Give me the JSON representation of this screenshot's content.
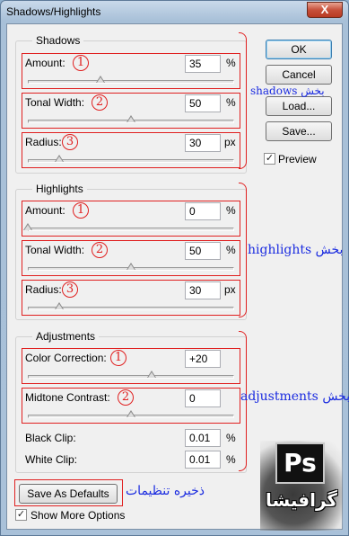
{
  "window": {
    "title": "Shadows/Highlights",
    "close_glyph": "X"
  },
  "shadows": {
    "title": "Shadows",
    "amount": {
      "label": "Amount:",
      "value": "35",
      "unit": "%",
      "level": 0.35
    },
    "tonal_width": {
      "label": "Tonal Width:",
      "value": "50",
      "unit": "%",
      "level": 0.5
    },
    "radius": {
      "label": "Radius:",
      "value": "30",
      "unit": "px",
      "level": 0.15
    }
  },
  "highlights": {
    "title": "Highlights",
    "amount": {
      "label": "Amount:",
      "value": "0",
      "unit": "%",
      "level": 0.0
    },
    "tonal_width": {
      "label": "Tonal Width:",
      "value": "50",
      "unit": "%",
      "level": 0.5
    },
    "radius": {
      "label": "Radius:",
      "value": "30",
      "unit": "px",
      "level": 0.15
    }
  },
  "adjustments": {
    "title": "Adjustments",
    "color_correction": {
      "label": "Color Correction:",
      "value": "+20",
      "level": 0.6
    },
    "midtone_contrast": {
      "label": "Midtone Contrast:",
      "value": "0",
      "level": 0.5
    },
    "black_clip": {
      "label": "Black Clip:",
      "value": "0.01",
      "unit": "%"
    },
    "white_clip": {
      "label": "White Clip:",
      "value": "0.01",
      "unit": "%"
    }
  },
  "buttons": {
    "ok": "OK",
    "cancel": "Cancel",
    "load": "Load...",
    "save": "Save...",
    "save_defaults": "Save As Defaults"
  },
  "checkboxes": {
    "preview": {
      "label": "Preview",
      "checked": true,
      "glyph": "✓"
    },
    "show_more": {
      "label": "Show More Options",
      "checked": true,
      "glyph": "✓"
    }
  },
  "annotations": {
    "num1": "1",
    "num2": "2",
    "num3": "3",
    "shadows_note": "shadows بخش",
    "highlights_note": "highlights بخش",
    "adjustments_note": "adjustments بخش",
    "defaults_note": "ذخیره تنظیمات"
  },
  "logo": {
    "ps": "Ps",
    "text": "گرافیشا"
  },
  "colors": {
    "annotation_red": "#e02020",
    "annotation_blue": "#1a2be0"
  }
}
